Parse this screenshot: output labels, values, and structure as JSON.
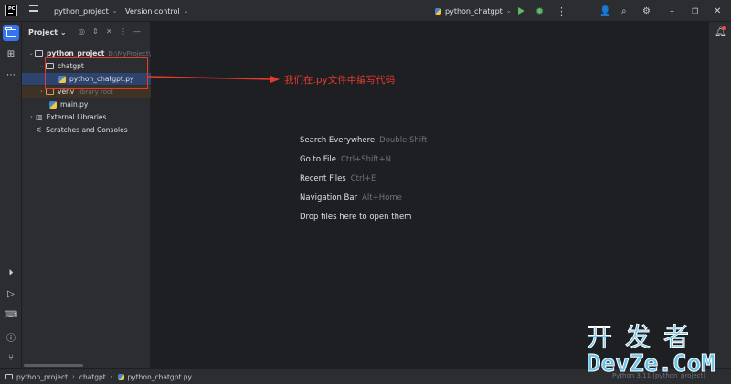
{
  "titlebar": {
    "project_name": "python_project",
    "vcs": "Version control",
    "run_config": "python_chatgpt"
  },
  "project_panel": {
    "title": "Project",
    "tree": {
      "root_label": "python_project",
      "root_path": "D:\\MyProject\\",
      "chatgpt_folder": "chatgpt",
      "chatgpt_file": "python_chatgpt.py",
      "venv_label": "venv",
      "venv_note": "library root",
      "main_file": "main.py",
      "external_libraries": "External Libraries",
      "scratches": "Scratches and Consoles"
    }
  },
  "annotation": {
    "text": "我们在.py文件中编写代码",
    "color": "#e53b2f"
  },
  "editor": {
    "hints": [
      {
        "label": "Search Everywhere",
        "key": "Double Shift"
      },
      {
        "label": "Go to File",
        "key": "Ctrl+Shift+N"
      },
      {
        "label": "Recent Files",
        "key": "Ctrl+E"
      },
      {
        "label": "Navigation Bar",
        "key": "Alt+Home"
      },
      {
        "label": "Drop files here to open them",
        "key": ""
      }
    ]
  },
  "statusbar": {
    "crumbs": [
      "python_project",
      "chatgpt",
      "python_chatgpt.py"
    ],
    "right_text": "Python 3.11 (python_project)"
  },
  "watermark": {
    "line1": "开发者",
    "line2": "DevZe.CoM"
  },
  "colors": {
    "accent": "#3574f0",
    "selection": "#2e436e",
    "annotation_red": "#e53b2f",
    "run_green": "#5fb865"
  },
  "icons": [
    "main-menu-icon",
    "folder-icon",
    "structure-icon",
    "more-icon",
    "run-icon",
    "debug-icon",
    "add-user-icon",
    "search-icon",
    "settings-icon",
    "notifications-icon",
    "terminal-icon",
    "problems-icon",
    "git-icon",
    "python-file-icon"
  ]
}
